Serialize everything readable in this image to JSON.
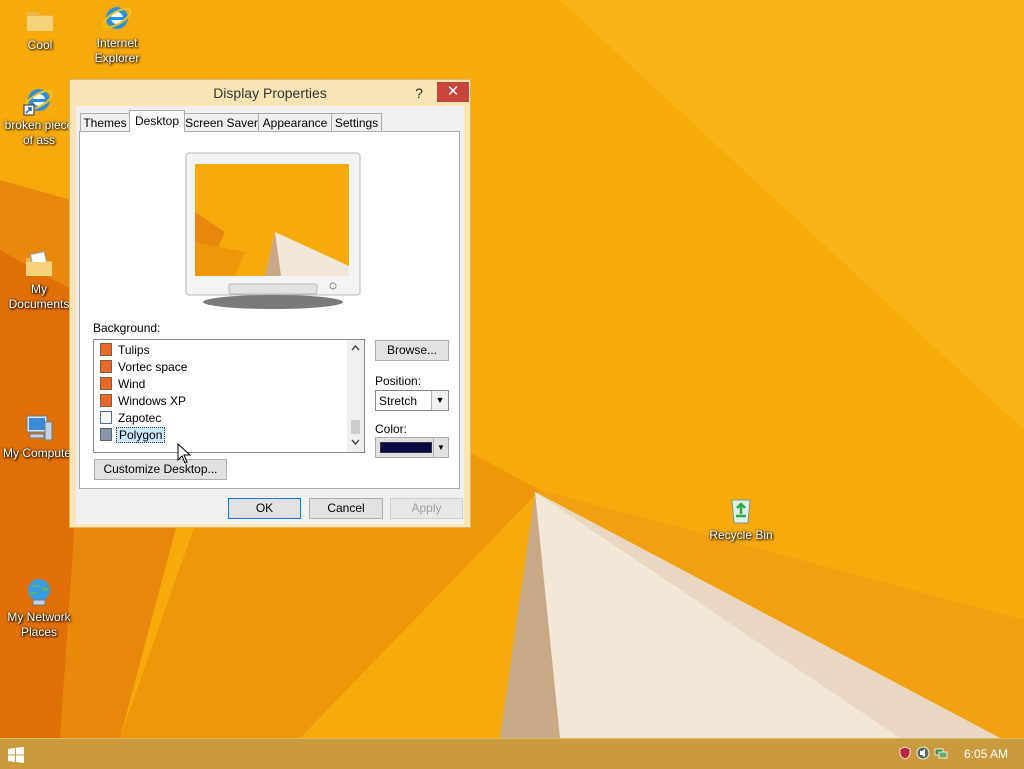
{
  "desktop": {
    "icons": [
      {
        "name": "Cool",
        "label_lines": [
          "Cool"
        ],
        "icon": "folder-icon"
      },
      {
        "name": "Internet Explorer",
        "label_lines": [
          "Internet",
          "Explorer"
        ],
        "icon": "internet-explorer-icon"
      },
      {
        "name": "broken piece of ass",
        "label_lines": [
          "broken piece",
          "of ass"
        ],
        "icon": "internet-explorer-shortcut-icon"
      },
      {
        "name": "My Documents",
        "label_lines": [
          "My",
          "Documents"
        ],
        "icon": "my-documents-icon"
      },
      {
        "name": "My Computer",
        "label_lines": [
          "My Computer"
        ],
        "icon": "my-computer-icon"
      },
      {
        "name": "My Network Places",
        "label_lines": [
          "My Network",
          "Places"
        ],
        "icon": "network-places-icon"
      },
      {
        "name": "Recycle Bin",
        "label_lines": [
          "Recycle Bin"
        ],
        "icon": "recycle-bin-icon"
      }
    ]
  },
  "dialog": {
    "title": "Display Properties",
    "help_label": "?",
    "close_label": "✕",
    "tabs": [
      {
        "label": "Themes",
        "active": false
      },
      {
        "label": "Desktop",
        "active": true
      },
      {
        "label": "Screen Saver",
        "active": false
      },
      {
        "label": "Appearance",
        "active": false
      },
      {
        "label": "Settings",
        "active": false
      }
    ],
    "background_label": "Background:",
    "background_list": [
      {
        "label": "Tulips",
        "icon": "image-file-icon",
        "selected": false
      },
      {
        "label": "Vortec space",
        "icon": "image-file-icon",
        "selected": false
      },
      {
        "label": "Wind",
        "icon": "image-file-icon",
        "selected": false
      },
      {
        "label": "Windows XP",
        "icon": "image-file-icon",
        "selected": false
      },
      {
        "label": "Zapotec",
        "icon": "html-file-icon",
        "selected": false
      },
      {
        "label": "Polygon",
        "icon": "image-file-icon",
        "selected": true
      }
    ],
    "browse_label": "Browse...",
    "position_label": "Position:",
    "position_value": "Stretch",
    "color_label": "Color:",
    "color_value": "#0c0a46",
    "customize_label": "Customize Desktop...",
    "ok_label": "OK",
    "cancel_label": "Cancel",
    "apply_label": "Apply"
  },
  "taskbar": {
    "clock": "6:05 AM",
    "tray_icons": [
      "security-shield-icon",
      "volume-icon",
      "network-icon"
    ]
  },
  "colors": {
    "wallpaper": "#f5a40a",
    "taskbar": "#c99a3e",
    "close_button": "#c7453b",
    "selection": "#cce8ff"
  }
}
